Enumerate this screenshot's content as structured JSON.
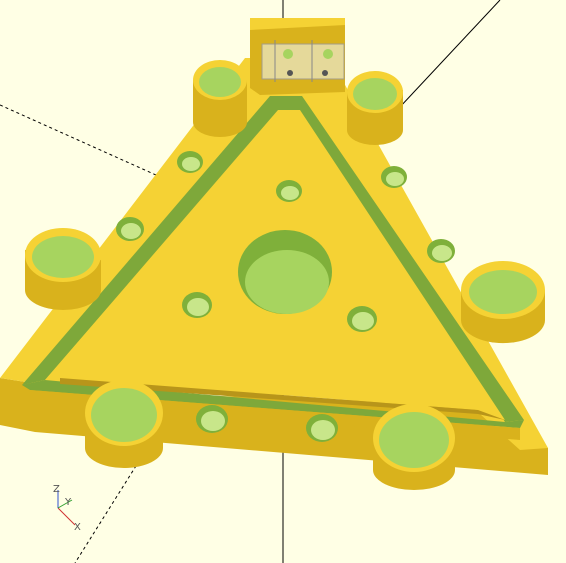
{
  "viewport": {
    "background": "#ffffe5",
    "model_color": "#f5d234",
    "model_shade": "#d9b21c",
    "model_dark": "#b8951a",
    "hole_color": "#a7d45f",
    "hole_rim": "#7fb03a",
    "groove_color": "#7ea83a",
    "axis_color": "#000000"
  },
  "axis_gizmo": {
    "x_label": "X",
    "y_label": "Y",
    "z_label": "Z",
    "x_color": "#d03030",
    "y_color": "#30a030",
    "z_color": "#3050d0"
  }
}
